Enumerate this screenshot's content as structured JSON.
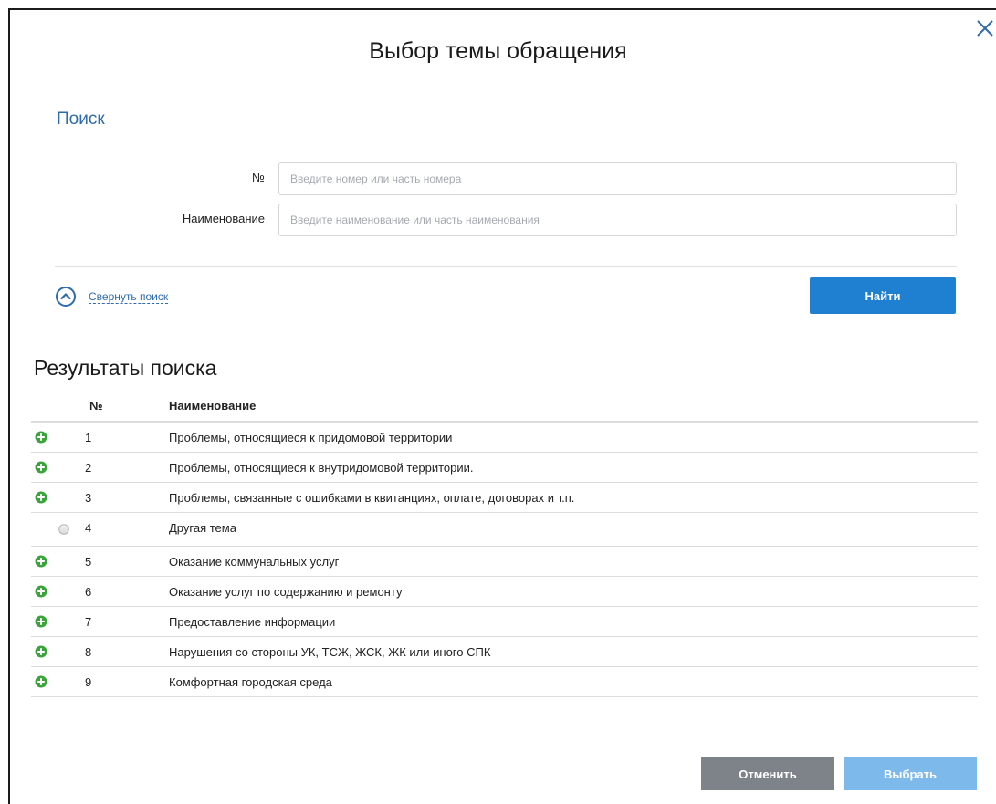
{
  "dialog": {
    "title": "Выбор темы обращения"
  },
  "search": {
    "heading": "Поиск",
    "number_label": "№",
    "number_placeholder": "Введите номер или часть номера",
    "number_value": "",
    "name_label": "Наименование",
    "name_placeholder": "Введите наименование или часть наименования",
    "name_value": "",
    "collapse_label": "Свернуть поиск",
    "find_label": "Найти"
  },
  "results": {
    "heading": "Результаты поиска",
    "columns": [
      "№",
      "Наименование"
    ],
    "rows": [
      {
        "num": "1",
        "name": "Проблемы, относящиеся к придомовой территории",
        "control": "expand"
      },
      {
        "num": "2",
        "name": "Проблемы, относящиеся к внутридомовой территории.",
        "control": "expand"
      },
      {
        "num": "3",
        "name": "Проблемы, связанные с ошибками в квитанциях, оплате, договорах и т.п.",
        "control": "expand"
      },
      {
        "num": "4",
        "name": "Другая тема",
        "control": "radio"
      },
      {
        "num": "5",
        "name": "Оказание коммунальных услуг",
        "control": "expand"
      },
      {
        "num": "6",
        "name": "Оказание услуг по содержанию и ремонту",
        "control": "expand"
      },
      {
        "num": "7",
        "name": "Предоставление информации",
        "control": "expand"
      },
      {
        "num": "8",
        "name": "Нарушения со стороны УК, ТСЖ, ЖСК, ЖК или иного СПК",
        "control": "expand"
      },
      {
        "num": "9",
        "name": "Комфортная городская среда",
        "control": "expand"
      }
    ]
  },
  "footer": {
    "cancel_label": "Отменить",
    "select_label": "Выбрать"
  },
  "colors": {
    "link_blue": "#2f6cad",
    "primary_button": "#1f7fd1",
    "cancel_button": "#7d8388",
    "select_button_disabled": "#7db9ea",
    "expand_icon_green": "#3aa33a"
  },
  "icons": {
    "close": "close-icon",
    "collapse": "chevron-up-circle-icon",
    "expand": "plus-circle-icon",
    "radio": "radio-button"
  }
}
